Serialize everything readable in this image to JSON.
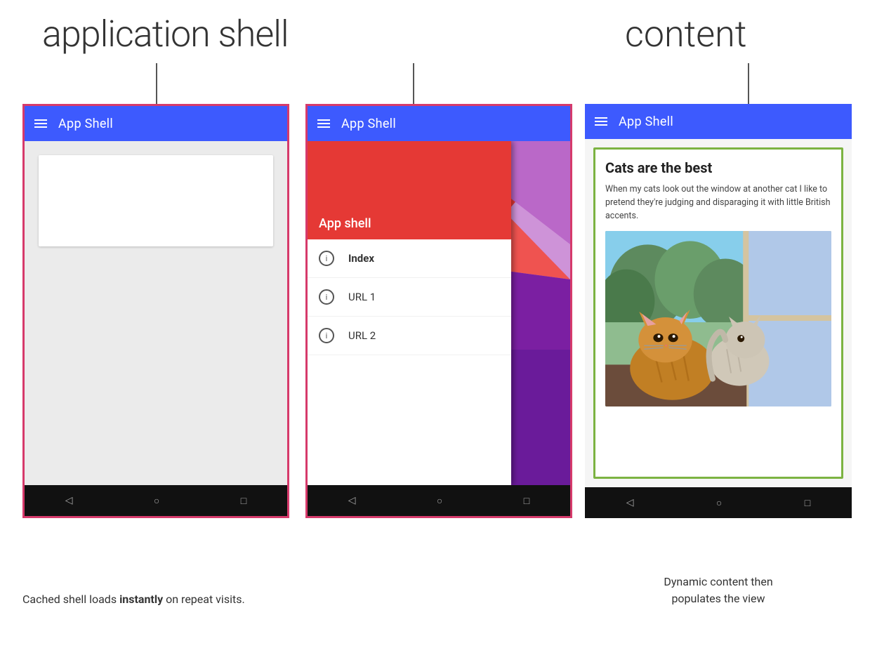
{
  "labels": {
    "application_shell": "application shell",
    "content": "content"
  },
  "phone1": {
    "app_bar_title": "App Shell",
    "border_color": "#d63a6b"
  },
  "phone2": {
    "app_bar_title": "App Shell",
    "drawer_header_title": "App shell",
    "drawer_items": [
      {
        "label": "Index",
        "bold": true
      },
      {
        "label": "URL 1",
        "bold": false
      },
      {
        "label": "URL 2",
        "bold": false
      }
    ]
  },
  "phone3": {
    "app_bar_title": "App Shell",
    "content_title": "Cats are the best",
    "content_text": "When my cats look out the window at another cat I like to pretend they're judging and disparaging it with little British accents."
  },
  "captions": {
    "left_part1": "Cached shell loads ",
    "left_bold": "instantly",
    "left_part2": " on repeat visits.",
    "right_line1": "Dynamic content then",
    "right_line2": "populates the view"
  },
  "nav": {
    "back": "◁",
    "home": "○",
    "recent": "□"
  },
  "icons": {
    "info": "i",
    "hamburger": "≡"
  }
}
